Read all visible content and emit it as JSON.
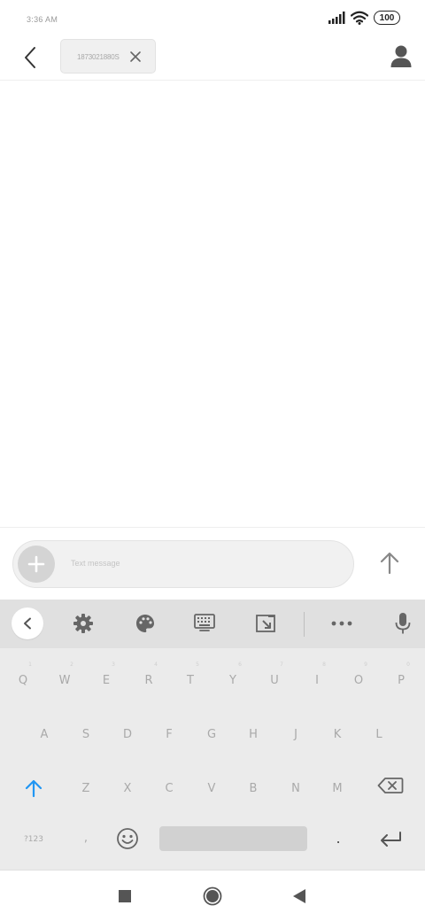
{
  "status_bar": {
    "time": "3:36 AM",
    "battery": "100",
    "icons": [
      "signal-icon",
      "wifi-icon",
      "battery-icon"
    ]
  },
  "app_bar": {
    "recipient": "1873021880S",
    "icons": [
      "back-arrow-icon",
      "close-icon",
      "contact-icon"
    ]
  },
  "compose": {
    "placeholder": "Text message",
    "icons": [
      "plus-icon",
      "send-arrow-icon"
    ]
  },
  "keyboard": {
    "toolbar_icons": [
      "chevron-left-icon",
      "gear-icon",
      "palette-icon",
      "keyboard-icon",
      "resize-icon",
      "more-icon",
      "microphone-icon"
    ],
    "row1": [
      {
        "key": "Q",
        "hint": "1"
      },
      {
        "key": "W",
        "hint": "2"
      },
      {
        "key": "E",
        "hint": "3"
      },
      {
        "key": "R",
        "hint": "4"
      },
      {
        "key": "T",
        "hint": "5"
      },
      {
        "key": "Y",
        "hint": "6"
      },
      {
        "key": "U",
        "hint": "7"
      },
      {
        "key": "I",
        "hint": "8"
      },
      {
        "key": "O",
        "hint": "9"
      },
      {
        "key": "P",
        "hint": "0"
      }
    ],
    "row2": [
      "A",
      "S",
      "D",
      "F",
      "G",
      "H",
      "J",
      "K",
      "L"
    ],
    "row3": [
      "Z",
      "X",
      "C",
      "V",
      "B",
      "N",
      "M"
    ],
    "row4": {
      "symbols": "?123",
      "comma": ",",
      "period": "."
    },
    "accent_color": "#2196f3"
  },
  "nav_bar": {
    "icons": [
      "recents-square-icon",
      "home-circle-icon",
      "back-triangle-icon"
    ]
  }
}
